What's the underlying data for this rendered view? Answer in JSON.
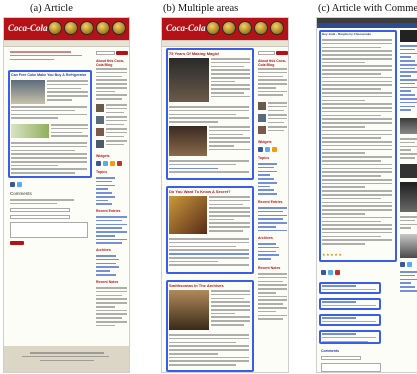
{
  "captions": {
    "a": "(a) Article",
    "b": "(b) Multiple areas",
    "c": "(c) Article with Comments"
  },
  "brand": {
    "logo_text": "Coca-Cola",
    "accent": "#b51218",
    "highlight": "#3b5ee6"
  },
  "article_a": {
    "title": "Can Free Coke Make You Buy A Refrigerator",
    "comments_heading": "Comments"
  },
  "sidebar": {
    "heading": "About this Coca-Cola Blog",
    "widgets_heading": "Widgets",
    "topics_heading": "Topics",
    "recent_heading": "Recent Entries",
    "archives_heading": "Archives",
    "recent_notes_heading": "Recent Notes"
  },
  "areas_b": {
    "area1_title": "75 Years Of Making Magic!",
    "area2_title": "Do You Want To Know A Secret?",
    "area3_title": "Smithsonian In The Archives"
  },
  "article_c": {
    "blog_title": "Hey Jude - Raspberry Cheesecake",
    "comments_heading": "Comments"
  }
}
